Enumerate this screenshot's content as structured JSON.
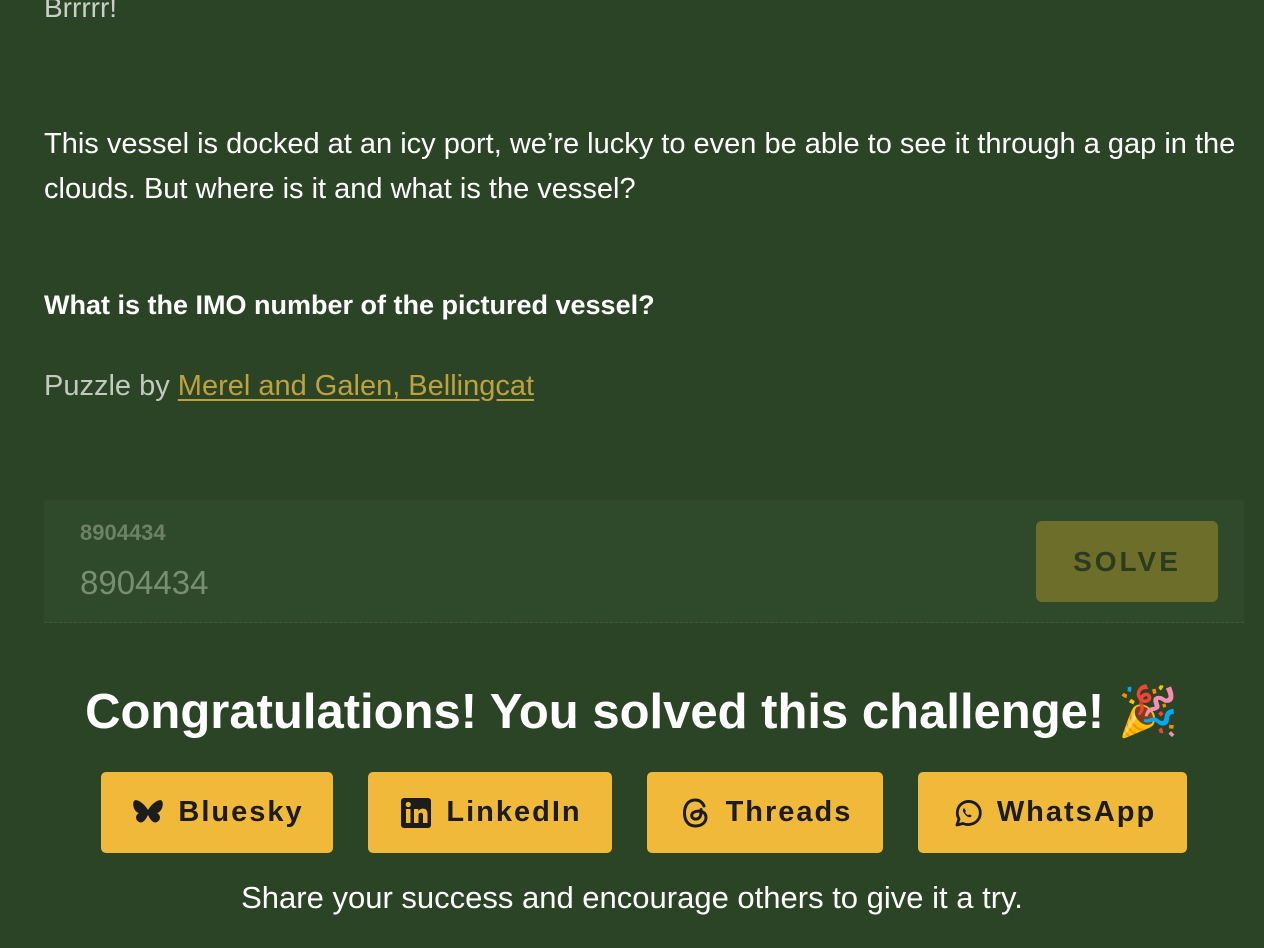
{
  "intro": "Brrrrr!",
  "description": "This vessel is docked at an icy port, we’re lucky to even be able to see it through a gap in the clouds. But where is it and what is the vessel?",
  "question": "What is the IMO number of the pictured vessel?",
  "credit": {
    "prefix": "Puzzle by ",
    "author": "Merel and Galen, Bellingcat"
  },
  "answer": {
    "label": "8904434",
    "value": "8904434",
    "solve_label": "SOLVE"
  },
  "congrats": {
    "title": "Congratulations! You solved this challenge!",
    "emoji": "🎉"
  },
  "share": {
    "buttons": [
      {
        "label": "Bluesky",
        "icon": "butterfly-icon"
      },
      {
        "label": "LinkedIn",
        "icon": "linkedin-icon"
      },
      {
        "label": "Threads",
        "icon": "threads-icon"
      },
      {
        "label": "WhatsApp",
        "icon": "whatsapp-icon"
      }
    ],
    "note": "Share your success and encourage others to give it a try."
  },
  "colors": {
    "background": "#2b4426",
    "link": "#bfa13e",
    "share_button": "#f0b93a",
    "solve_button": "#6c6e2a"
  }
}
